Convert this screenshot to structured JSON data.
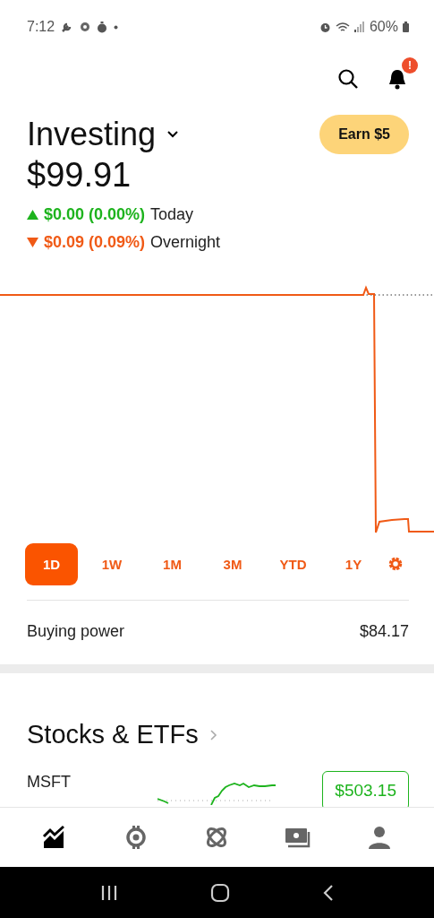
{
  "status_bar": {
    "time": "7:12",
    "battery": "60%"
  },
  "header": {
    "notification_badge": "!"
  },
  "account": {
    "title": "Investing",
    "earn_button": "Earn $5",
    "value": "$99.91"
  },
  "changes": [
    {
      "rising": true,
      "amount": "$0.00 (0.00%)",
      "period": "Today"
    },
    {
      "rising": false,
      "amount": "$0.09 (0.09%)",
      "period": "Overnight"
    }
  ],
  "ranges": [
    {
      "label": "1D",
      "selected": true
    },
    {
      "label": "1W",
      "selected": false
    },
    {
      "label": "1M",
      "selected": false
    },
    {
      "label": "3M",
      "selected": false
    },
    {
      "label": "YTD",
      "selected": false
    },
    {
      "label": "1Y",
      "selected": false
    }
  ],
  "buying_power": {
    "label": "Buying power",
    "value": "$84.17"
  },
  "stocks": {
    "title": "Stocks & ETFs",
    "rows": [
      {
        "symbol": "MSFT",
        "price": "$503.15"
      }
    ]
  },
  "nav": [
    {
      "kind": "chart",
      "selected": true
    },
    {
      "kind": "crypto",
      "selected": false
    },
    {
      "kind": "orbit",
      "selected": false
    },
    {
      "kind": "cash",
      "selected": false
    },
    {
      "kind": "account",
      "selected": false
    }
  ]
}
